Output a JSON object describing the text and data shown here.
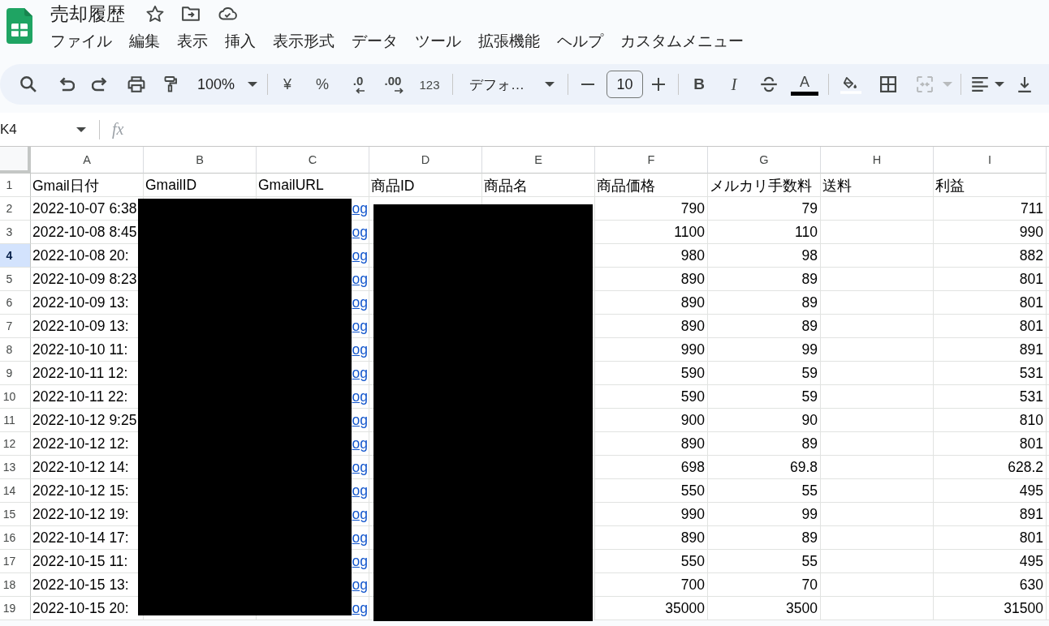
{
  "document": {
    "title": "売却履歴"
  },
  "menu": [
    "ファイル",
    "編集",
    "表示",
    "挿入",
    "表示形式",
    "データ",
    "ツール",
    "拡張機能",
    "ヘルプ",
    "カスタムメニュー"
  ],
  "toolbar": {
    "zoom": "100%",
    "currency": "¥",
    "percent": "%",
    "decrease_decimals": ".0",
    "increase_decimals": ".00",
    "number_format": "123",
    "font": "デフォ…",
    "font_size": "10",
    "bold": "B",
    "italic": "I",
    "text_color": "A",
    "merge": {
      "disabled": true
    }
  },
  "formula_bar": {
    "name_box": "K4",
    "fx": "fx"
  },
  "sheet": {
    "columns": [
      "A",
      "B",
      "C",
      "D",
      "E",
      "F",
      "G",
      "H",
      "I"
    ],
    "rows": [
      {
        "kind": "header",
        "number": "1",
        "selected": false,
        "cells": [
          "Gmail日付",
          "GmailID",
          "GmailURL",
          "商品ID",
          "商品名",
          "商品価格",
          "メルカリ手数料",
          "送料",
          "利益"
        ]
      },
      {
        "kind": "data",
        "number": "2",
        "selected": false,
        "date": "2022-10-07 6:38",
        "url": "og",
        "price": "790",
        "fee": "79",
        "profit": "711"
      },
      {
        "kind": "data",
        "number": "3",
        "selected": false,
        "date": "2022-10-08 8:45",
        "url": "og",
        "price": "1100",
        "fee": "110",
        "profit": "990"
      },
      {
        "kind": "data",
        "number": "4",
        "selected": true,
        "date": "2022-10-08 20:",
        "url": "og",
        "price": "980",
        "fee": "98",
        "profit": "882"
      },
      {
        "kind": "data",
        "number": "5",
        "selected": false,
        "date": "2022-10-09 8:23",
        "url": "og",
        "price": "890",
        "fee": "89",
        "profit": "801"
      },
      {
        "kind": "data",
        "number": "6",
        "selected": false,
        "date": "2022-10-09 13:",
        "url": "og",
        "price": "890",
        "fee": "89",
        "profit": "801"
      },
      {
        "kind": "data",
        "number": "7",
        "selected": false,
        "date": "2022-10-09 13:",
        "url": "og",
        "price": "890",
        "fee": "89",
        "profit": "801"
      },
      {
        "kind": "data",
        "number": "8",
        "selected": false,
        "date": "2022-10-10 11:",
        "url": "og",
        "price": "990",
        "fee": "99",
        "profit": "891"
      },
      {
        "kind": "data",
        "number": "9",
        "selected": false,
        "date": "2022-10-11 12:",
        "url": "og",
        "price": "590",
        "fee": "59",
        "profit": "531"
      },
      {
        "kind": "data",
        "number": "10",
        "selected": false,
        "date": "2022-10-11 22:",
        "url": "og",
        "price": "590",
        "fee": "59",
        "profit": "531"
      },
      {
        "kind": "data",
        "number": "11",
        "selected": false,
        "date": "2022-10-12 9:25",
        "url": "og",
        "price": "900",
        "fee": "90",
        "profit": "810"
      },
      {
        "kind": "data",
        "number": "12",
        "selected": false,
        "date": "2022-10-12 12:",
        "url": "og",
        "price": "890",
        "fee": "89",
        "profit": "801"
      },
      {
        "kind": "data",
        "number": "13",
        "selected": false,
        "date": "2022-10-12 14:",
        "url": "og",
        "price": "698",
        "fee": "69.8",
        "profit": "628.2"
      },
      {
        "kind": "data",
        "number": "14",
        "selected": false,
        "date": "2022-10-12 15:",
        "url": "og",
        "price": "550",
        "fee": "55",
        "profit": "495"
      },
      {
        "kind": "data",
        "number": "15",
        "selected": false,
        "date": "2022-10-12 19:",
        "url": "og",
        "price": "990",
        "fee": "99",
        "profit": "891"
      },
      {
        "kind": "data",
        "number": "16",
        "selected": false,
        "date": "2022-10-14 17:",
        "url": "og",
        "price": "890",
        "fee": "89",
        "profit": "801"
      },
      {
        "kind": "data",
        "number": "17",
        "selected": false,
        "date": "2022-10-15 11:",
        "url": "og",
        "price": "550",
        "fee": "55",
        "profit": "495"
      },
      {
        "kind": "data",
        "number": "18",
        "selected": false,
        "date": "2022-10-15 13:",
        "url": "og",
        "price": "700",
        "fee": "70",
        "profit": "630"
      },
      {
        "kind": "data",
        "number": "19",
        "selected": false,
        "date": "2022-10-15 20:",
        "url": "og",
        "price": "35000",
        "fee": "3500",
        "profit": "31500"
      }
    ]
  }
}
